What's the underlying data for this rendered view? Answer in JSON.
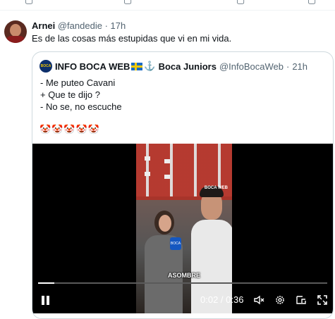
{
  "tweet": {
    "author_name": "Arnei",
    "author_handle": "@fandedie",
    "separator": "·",
    "time": "17h",
    "text": "Es de las cosas más estupidas que vi en mi vida."
  },
  "quote": {
    "avatar_text": "BOCA",
    "author_name": "INFO BOCA WEB",
    "author_suffix": "Boca Juniors",
    "author_handle": "@InfoBocaWeb",
    "separator": "·",
    "time": "21h",
    "lines": [
      "- Me puteo Cavani",
      "+ Que te dijo ?",
      "- No se, no escuche"
    ],
    "emoji": "🤡🤡🤡🤡🤡"
  },
  "video": {
    "caption": "ASOMBRE",
    "watermark": "BOCA WEB",
    "mic_text": "BOCA",
    "time_display": "0:02 / 0:36",
    "progress_fraction": 0.056
  },
  "icons": {
    "play_state": "pause-icon",
    "volume": "volume-muted-icon",
    "settings": "gear-icon",
    "pip": "picture-in-picture-icon",
    "fullscreen": "fullscreen-icon"
  }
}
